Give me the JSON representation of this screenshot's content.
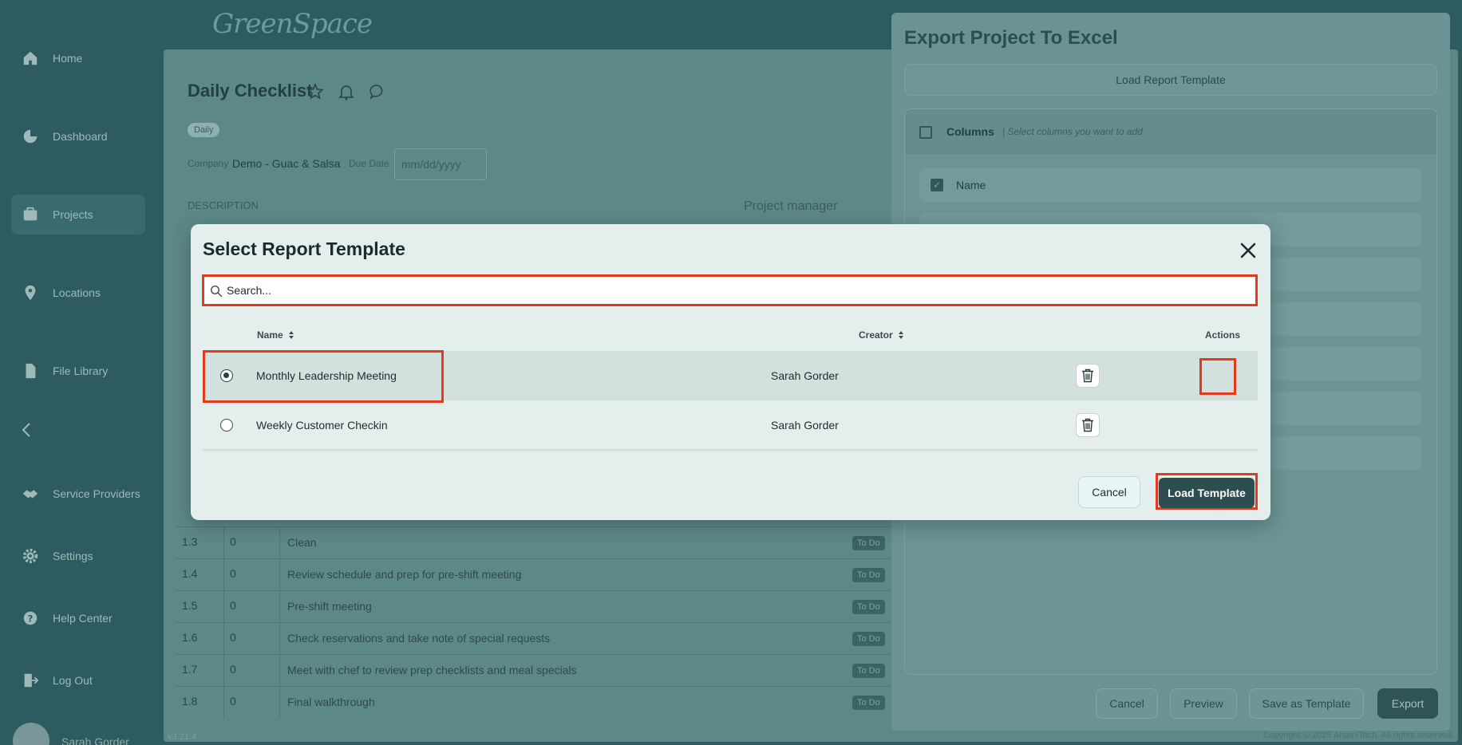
{
  "app": {
    "logo": "GreenSpace",
    "version": "v3.21.4",
    "copyright": "Copyright © 2025 AnamiTech. All rights reserved."
  },
  "sidebar": {
    "items": [
      {
        "label": "Home",
        "icon": "home-icon"
      },
      {
        "label": "Dashboard",
        "icon": "pie-chart-icon"
      },
      {
        "label": "Projects",
        "icon": "projects-icon",
        "active": true
      },
      {
        "label": "Locations",
        "icon": "location-pin-icon"
      },
      {
        "label": "File Library",
        "icon": "file-icon"
      },
      {
        "label": "Service Providers",
        "icon": "handshake-icon"
      },
      {
        "label": "Settings",
        "icon": "gear-icon"
      },
      {
        "label": "Help Center",
        "icon": "help-icon"
      },
      {
        "label": "Log Out",
        "icon": "logout-icon"
      }
    ],
    "user_name": "Sarah Gorder"
  },
  "project": {
    "title": "Daily Checklist",
    "tag": "Daily",
    "company_label": "Company",
    "company_value": "Demo - Guac & Salsa",
    "due_date_label": "Due Date",
    "due_date_placeholder": "mm/dd/yyyy",
    "description_label": "DESCRIPTION",
    "pm_label": "Project manager",
    "tasks": [
      {
        "num": "1.3",
        "count": "0",
        "name": "Clean",
        "status": "To Do"
      },
      {
        "num": "1.4",
        "count": "0",
        "name": "Review schedule and prep for pre-shift meeting",
        "status": "To Do"
      },
      {
        "num": "1.5",
        "count": "0",
        "name": "Pre-shift meeting",
        "status": "To Do"
      },
      {
        "num": "1.6",
        "count": "0",
        "name": "Check reservations and take note of special requests",
        "status": "To Do"
      },
      {
        "num": "1.7",
        "count": "0",
        "name": "Meet with chef to review prep checklists and meal specials",
        "status": "To Do"
      },
      {
        "num": "1.8",
        "count": "0",
        "name": "Final walkthrough",
        "status": "To Do"
      }
    ]
  },
  "export_panel": {
    "title": "Export Project To Excel",
    "load_template_label": "Load Report Template",
    "columns_title": "Columns",
    "columns_subtitle": "Select columns you want to add",
    "first_column": "Name",
    "footer": {
      "cancel": "Cancel",
      "preview": "Preview",
      "save_template": "Save as Template",
      "export": "Export"
    }
  },
  "modal": {
    "title": "Select Report Template",
    "search_placeholder": "Search...",
    "columns": {
      "name": "Name",
      "creator": "Creator",
      "actions": "Actions"
    },
    "rows": [
      {
        "name": "Monthly Leadership Meeting",
        "creator": "Sarah Gorder",
        "selected": true
      },
      {
        "name": "Weekly Customer Checkin",
        "creator": "Sarah Gorder",
        "selected": false
      }
    ],
    "cancel_label": "Cancel",
    "load_label": "Load Template"
  },
  "colors": {
    "highlight": "#e23a1e",
    "primary": "#2c4e51",
    "modal_bg": "#e4efed"
  }
}
